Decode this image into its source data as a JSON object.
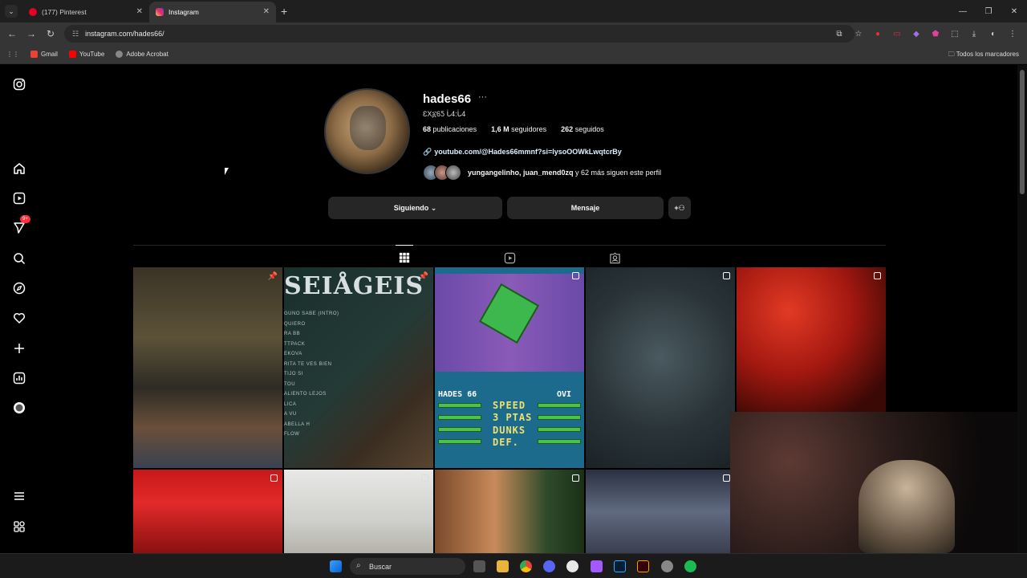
{
  "browser": {
    "tabs": [
      {
        "label": "(177) Pinterest",
        "active": false,
        "color": "#e60023"
      },
      {
        "label": "Instagram",
        "active": true,
        "color": "#e1306c"
      }
    ],
    "url": "instagram.com/hades66/",
    "bookmarks": [
      {
        "label": "Gmail",
        "color": "#ea4335"
      },
      {
        "label": "YouTube",
        "color": "#ff0000"
      },
      {
        "label": "Adobe Acrobat",
        "color": "#888888"
      }
    ],
    "bookmarks_right": "Todos los marcadores"
  },
  "sidebar": {
    "notifications_badge": "9+"
  },
  "profile": {
    "username": "hades66",
    "more_icon": "···",
    "full_name": "ƐX፩6Ƽ ᒑ4:ᒑ4",
    "stats": [
      {
        "value": "68",
        "label": "publicaciones"
      },
      {
        "value": "1,6 M",
        "label": "seguidores"
      },
      {
        "value": "262",
        "label": "seguidos"
      }
    ],
    "link": "youtube.com/@Hades66mmnf?si=lysoOOWkLwqtcrBy",
    "followed_by_names": "yungangelinho, juan_mend0zq",
    "followed_by_rest": " y 62 más siguen este perfil",
    "buttons": {
      "following": "Siguiendo ⌄",
      "message": "Mensaje",
      "add_user": "+⚇"
    }
  },
  "posts": {
    "album_title": "SEIÅGEIS",
    "album_tracks": [
      "GUNO SABE (INTRO)",
      "QUIERO",
      "RA BB",
      "TTPACK",
      "EKOVA",
      "RITA TE VES BIEN",
      "TIJO SI",
      "TOU",
      "ALIENTO LEJOS",
      "LICA",
      "A VU",
      "ABELLA H",
      "FLOW"
    ],
    "game_left": "HADES 66",
    "game_right": "OVI",
    "game_stats": [
      "SPEED",
      "3 PTAS",
      "DUNKS",
      "DEF."
    ]
  },
  "taskbar": {
    "search_label": "Buscar"
  },
  "colors": {
    "background": "#000000",
    "surface": "#262626",
    "link": "#e0f1ff",
    "badge": "#ff3040"
  }
}
